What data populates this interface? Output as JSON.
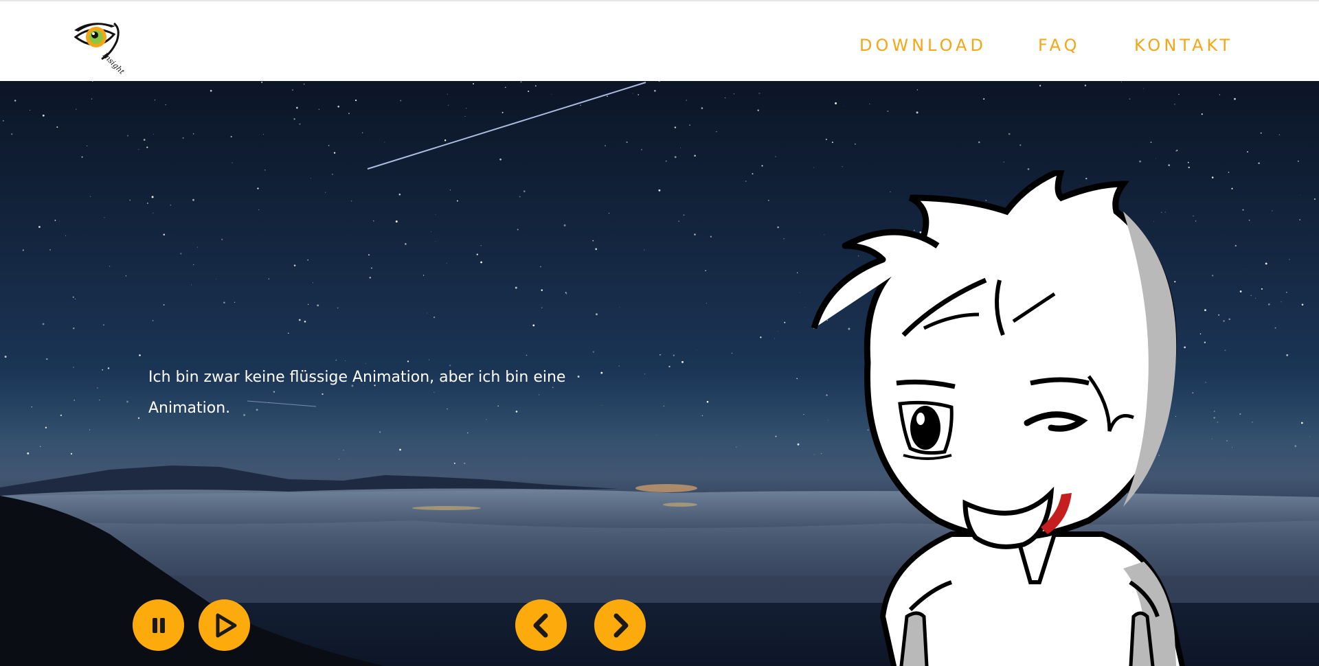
{
  "header": {
    "logo_text": "Insight",
    "nav": [
      {
        "label": "DOWNLOAD"
      },
      {
        "label": "FAQ"
      },
      {
        "label": "KONTAKT"
      }
    ],
    "accent_color": "#f6a515"
  },
  "hero": {
    "caption": "Ich bin zwar keine flüssige Animation, aber ich bin eine Animation.",
    "controls": {
      "pause": "pause-icon",
      "play": "play-icon",
      "prev": "chevron-left-icon",
      "next": "chevron-right-icon"
    },
    "button_color": "#fdab0c"
  }
}
